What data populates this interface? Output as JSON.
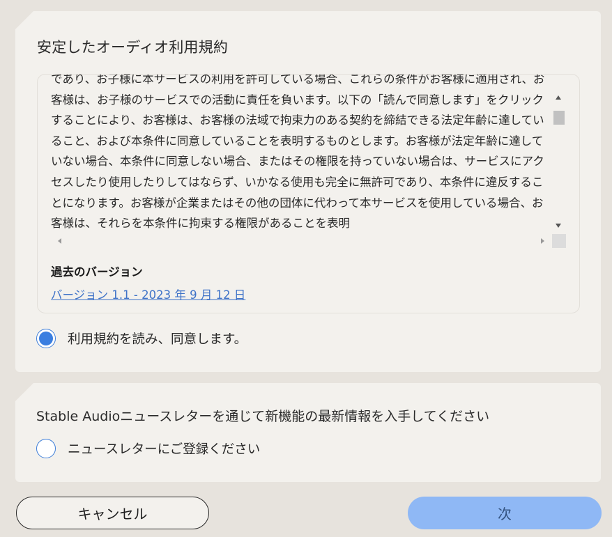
{
  "terms": {
    "title": "安定したオーディオ利用規約",
    "body": "であり、お子様に本サービスの利用を許可している場合、これらの条件がお客様に適用され、お客様は、お子様のサービスでの活動に責任を負います。以下の「読んで同意します」をクリックすることにより、お客様は、お客様の法域で拘束力のある契約を締結できる法定年齢に達していること、および本条件に同意していることを表明するものとします。お客様が法定年齢に達していない場合、本条件に同意しない場合、またはその権限を持っていない場合は、サービスにアクセスしたり使用したりしてはならず、いかなる使用も完全に無許可であり、本条件に違反することになります。お客様が企業またはその他の団体に代わって本サービスを使用している場合、お客様は、それらを本条件に拘束する権限があることを表明",
    "previous_versions_label": "過去のバージョン",
    "version_link": "バージョン 1.1 - 2023 年 9 月 12 日",
    "agree_label": "利用規約を読み、同意します。",
    "agree_checked": true
  },
  "newsletter": {
    "title": "Stable Audioニュースレターを通じて新機能の最新情報を入手してください",
    "subscribe_label": "ニュースレターにご登録ください",
    "subscribe_checked": false
  },
  "buttons": {
    "cancel": "キャンセル",
    "next": "次"
  },
  "colors": {
    "accent": "#3a7ee0",
    "next_button": "#8fb8f5",
    "link": "#3f73c8",
    "card": "#f3f1ed",
    "background": "#e7e3dd"
  }
}
